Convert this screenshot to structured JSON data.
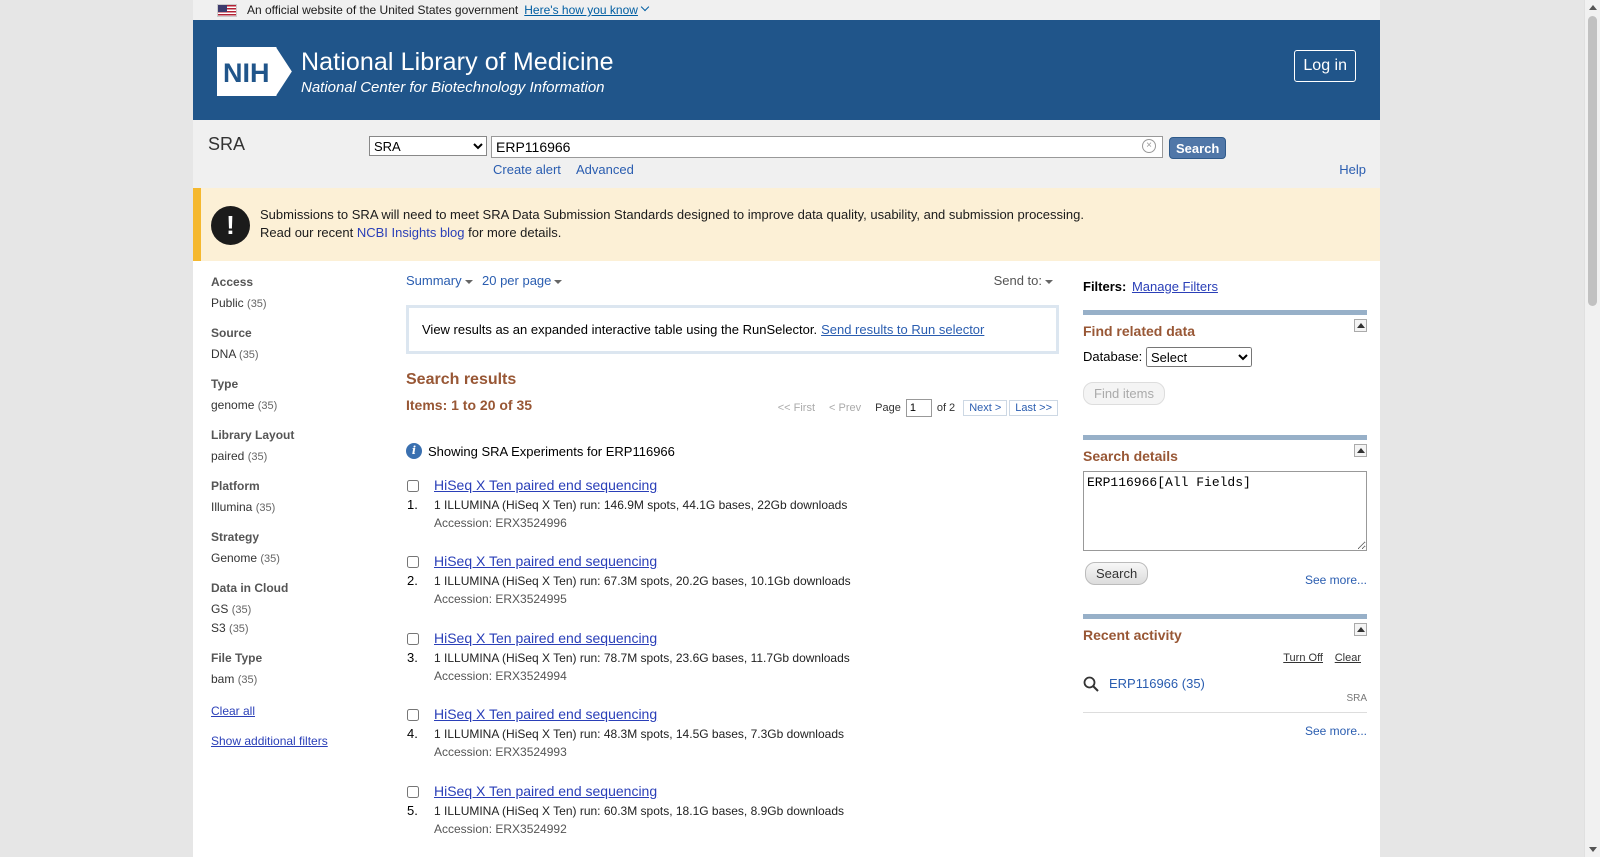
{
  "gov_banner": {
    "text": "An official website of the United States government",
    "link": "Here's how you know"
  },
  "header": {
    "logo_text": "NIH",
    "title": "National Library of Medicine",
    "subtitle": "National Center for Biotechnology Information",
    "login_label": "Log in"
  },
  "search": {
    "db_name": "SRA",
    "db_selected": "SRA",
    "term": "ERP116966",
    "button_label": "Search",
    "create_alert": "Create alert",
    "advanced": "Advanced",
    "help": "Help"
  },
  "alert": {
    "line1": "Submissions to SRA will need to meet SRA Data Submission Standards designed to improve data quality, usability, and submission processing.",
    "line2_prefix": "Read our recent",
    "line2_link": "NCBI Insights blog",
    "line2_suffix": "for more details."
  },
  "facets": [
    {
      "title": "Access",
      "options": [
        {
          "label": "Public",
          "count": "(35)"
        }
      ]
    },
    {
      "title": "Source",
      "options": [
        {
          "label": "DNA",
          "count": "(35)"
        }
      ]
    },
    {
      "title": "Type",
      "options": [
        {
          "label": "genome",
          "count": "(35)"
        }
      ]
    },
    {
      "title": "Library Layout",
      "options": [
        {
          "label": "paired",
          "count": "(35)"
        }
      ]
    },
    {
      "title": "Platform",
      "options": [
        {
          "label": "Illumina",
          "count": "(35)"
        }
      ]
    },
    {
      "title": "Strategy",
      "options": [
        {
          "label": "Genome",
          "count": "(35)"
        }
      ]
    },
    {
      "title": "Data in Cloud",
      "options": [
        {
          "label": "GS",
          "count": "(35)"
        },
        {
          "label": "S3",
          "count": "(35)"
        }
      ]
    },
    {
      "title": "File Type",
      "options": [
        {
          "label": "bam",
          "count": "(35)"
        }
      ]
    }
  ],
  "facet_links": {
    "clear_all": "Clear all",
    "show_additional": "Show additional filters"
  },
  "controls": {
    "summary": "Summary",
    "per_page": "20 per page",
    "send_to": "Send to:"
  },
  "run_selector": {
    "text": "View results as an expanded interactive table using the RunSelector.",
    "link": "Send results to Run selector"
  },
  "results": {
    "title": "Search results",
    "items_label": "Items: 1 to 20 of 35",
    "showing_text": "Showing SRA Experiments for ERP116966",
    "pager": {
      "first": "<< First",
      "prev": "< Prev",
      "page_label": "Page",
      "page_value": "1",
      "of": "of 2",
      "next": "Next >",
      "last": "Last >>"
    },
    "items": [
      {
        "num": "1.",
        "title": "HiSeq X Ten paired end sequencing",
        "desc": "1 ILLUMINA (HiSeq X Ten) run: 146.9M spots, 44.1G bases, 22Gb downloads",
        "accession": "Accession: ERX3524996"
      },
      {
        "num": "2.",
        "title": "HiSeq X Ten paired end sequencing",
        "desc": "1 ILLUMINA (HiSeq X Ten) run: 67.3M spots, 20.2G bases, 10.1Gb downloads",
        "accession": "Accession: ERX3524995"
      },
      {
        "num": "3.",
        "title": "HiSeq X Ten paired end sequencing",
        "desc": "1 ILLUMINA (HiSeq X Ten) run: 78.7M spots, 23.6G bases, 11.7Gb downloads",
        "accession": "Accession: ERX3524994"
      },
      {
        "num": "4.",
        "title": "HiSeq X Ten paired end sequencing",
        "desc": "1 ILLUMINA (HiSeq X Ten) run: 48.3M spots, 14.5G bases, 7.3Gb downloads",
        "accession": "Accession: ERX3524993"
      },
      {
        "num": "5.",
        "title": "HiSeq X Ten paired end sequencing",
        "desc": "1 ILLUMINA (HiSeq X Ten) run: 60.3M spots, 18.1G bases, 8.9Gb downloads",
        "accession": "Accession: ERX3524992"
      }
    ]
  },
  "right": {
    "filters_label": "Filters:",
    "manage_filters": "Manage Filters",
    "find_related": {
      "title": "Find related data",
      "database_label": "Database:",
      "database_selected": "Select",
      "find_button": "Find items"
    },
    "search_details": {
      "title": "Search details",
      "query": "ERP116966[All Fields]",
      "search_button": "Search",
      "see_more": "See more..."
    },
    "recent_activity": {
      "title": "Recent activity",
      "turn_off": "Turn Off",
      "clear": "Clear",
      "item_label": "ERP116966 (35)",
      "item_db": "SRA",
      "see_more": "See more..."
    }
  },
  "colors": {
    "header_bg": "#20558a",
    "section_title": "#985735",
    "link": "#2a3fb8",
    "alert_bg": "#fcf0d6",
    "alert_border": "#f5b82e"
  }
}
